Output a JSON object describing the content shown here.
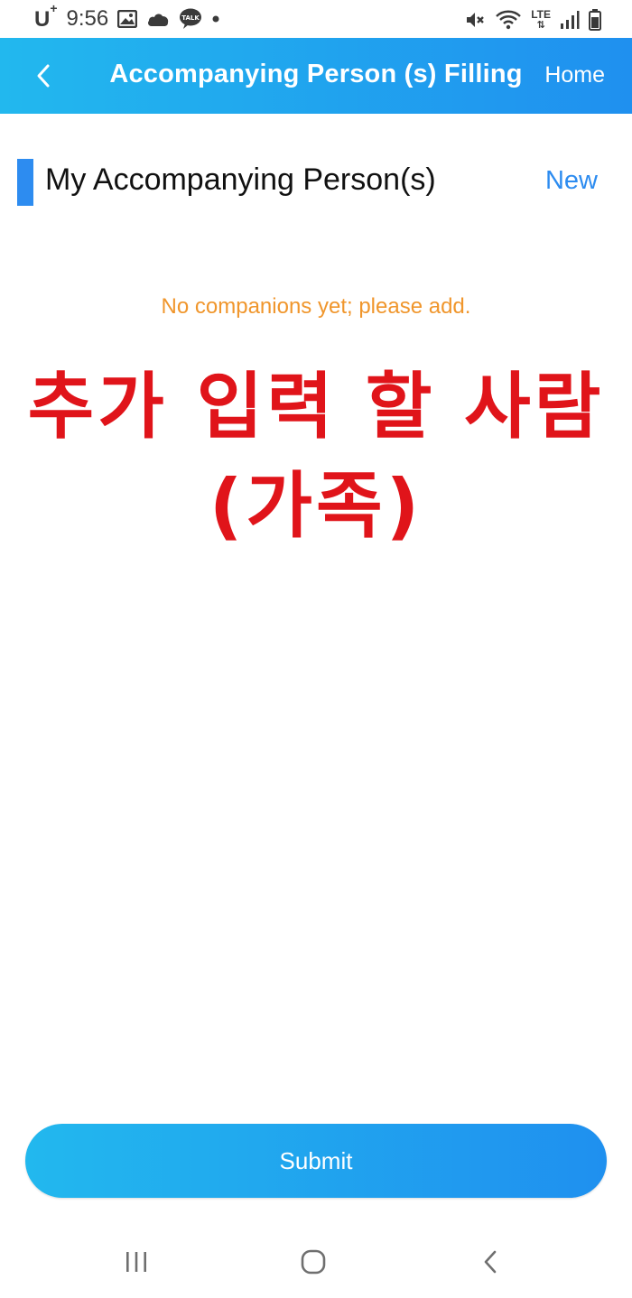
{
  "status_bar": {
    "carrier": "U",
    "carrier_sup": "+",
    "time": "9:56",
    "network_label": "LTE"
  },
  "header": {
    "title": "Accompanying Person (s) Filling",
    "home_label": "Home"
  },
  "section": {
    "title": "My Accompanying Person(s)",
    "new_label": "New"
  },
  "empty_message": "No companions yet; please add.",
  "annotation": {
    "line1": "추가 입력 할 사람",
    "line2": "(가족)"
  },
  "submit_label": "Submit",
  "colors": {
    "header_gradient_start": "#22b8ee",
    "header_gradient_end": "#1f90ef",
    "accent_blue": "#2d8cf0",
    "empty_message_orange": "#f0962c",
    "annotation_red": "#e0141a"
  },
  "icons": {
    "back": "chevron-left-icon",
    "gallery": "image-icon",
    "cloud": "cloud-icon",
    "talk": "talk-bubble-icon",
    "mute": "mute-icon",
    "wifi": "wifi-icon",
    "signal": "signal-icon",
    "battery": "battery-icon",
    "nav_recents": "recents-icon",
    "nav_home": "home-circle-icon",
    "nav_back": "nav-back-icon"
  }
}
